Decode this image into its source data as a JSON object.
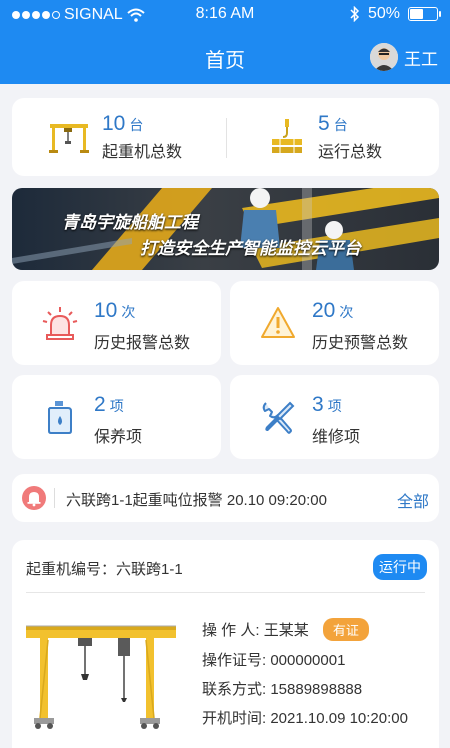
{
  "status_bar": {
    "carrier": "SIGNAL",
    "time": "8:16 AM",
    "battery_pct": "50%",
    "battery_level": 0.5
  },
  "nav": {
    "title": "首页",
    "username": "王工"
  },
  "counts": [
    {
      "num": "10",
      "unit": "台",
      "label": "起重机总数",
      "icon": "gantry-crane-icon"
    },
    {
      "num": "5",
      "unit": "台",
      "label": "运行总数",
      "icon": "crane-hook-icon"
    }
  ],
  "banner": {
    "line1": "青岛宇旋船舶工程",
    "line2": "打造安全生产智能监控云平台"
  },
  "stats": [
    {
      "num": "10",
      "unit": "次",
      "label": "历史报警总数",
      "icon": "alarm-siren-icon"
    },
    {
      "num": "20",
      "unit": "次",
      "label": "历史预警总数",
      "icon": "warning-triangle-icon"
    },
    {
      "num": "2",
      "unit": "项",
      "label": "保养项",
      "icon": "oil-can-icon"
    },
    {
      "num": "3",
      "unit": "项",
      "label": "维修项",
      "icon": "tools-icon"
    }
  ],
  "alert": {
    "text": "六联跨1-1起重吨位报警 20.10 09:20:00",
    "all_label": "全部"
  },
  "detail": {
    "crane_id_label": "起重机编号：",
    "crane_id": "六联跨1-1",
    "status": "运行中",
    "operator_label": "操 作 人:",
    "operator": "王某某",
    "cert_badge": "有证",
    "cert_no_label": "操作证号:",
    "cert_no": "000000001",
    "contact_label": "联系方式:",
    "contact": "15889898888",
    "start_label": "开机时间:",
    "start_time": "2021.10.09 10:20:00"
  },
  "colors": {
    "primary": "#1e8af2",
    "accent_text": "#2f78c7",
    "crane_yellow": "#f2c12e",
    "alert_red": "#e85a5a",
    "cert_orange": "#f3a33b"
  }
}
